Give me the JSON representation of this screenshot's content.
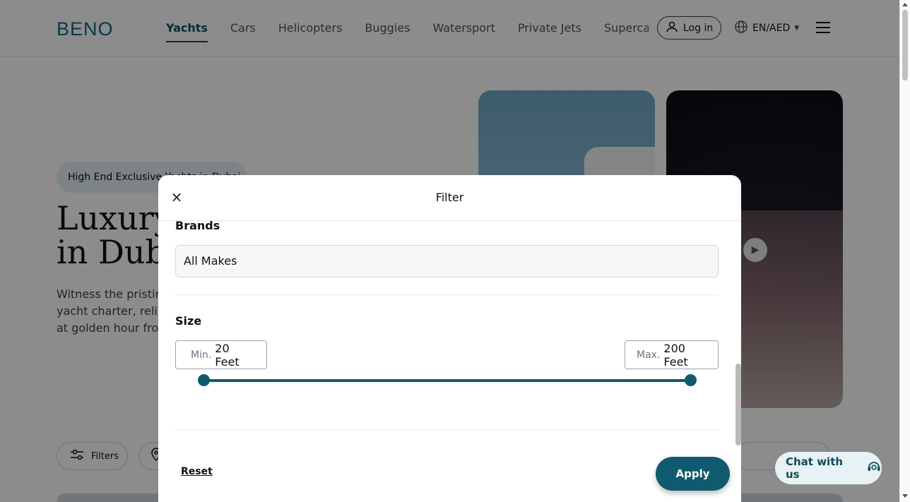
{
  "header": {
    "logo": "BENO",
    "nav": [
      "Yachts",
      "Cars",
      "Helicopters",
      "Buggies",
      "Watersport",
      "Private Jets",
      "Supercars"
    ],
    "active_nav": "Yachts",
    "login_label": "Log in",
    "language": "EN/AED"
  },
  "hero": {
    "badge": "High End Exclusive Yachts in Dubai",
    "title_line1": "Luxury",
    "title_line2": "in Duba",
    "lead_line1": "Witness the pristin",
    "lead_line2": "yacht charter, relis",
    "lead_line3": "at golden hour fro"
  },
  "toolbar": {
    "filters_label": "Filters"
  },
  "chat": {
    "label": "Chat with us"
  },
  "modal": {
    "title": "Filter",
    "brands": {
      "label": "Brands",
      "value": "All Makes"
    },
    "size": {
      "label": "Size",
      "min_prefix": "Min.",
      "min_value": "20 Feet",
      "max_prefix": "Max.",
      "max_value": "200 Feet"
    },
    "reset_label": "Reset",
    "apply_label": "Apply"
  },
  "colors": {
    "brand": "#0f5a6e",
    "logo": "#0e6a7e",
    "badge_bg": "#e3f0f2"
  }
}
